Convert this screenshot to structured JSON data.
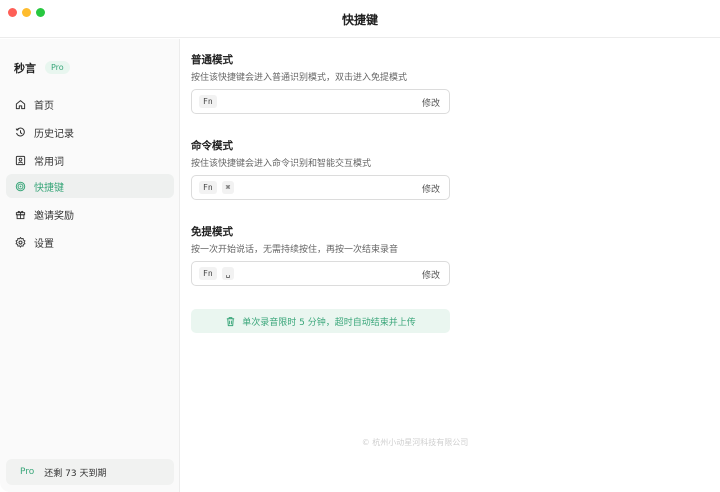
{
  "window": {
    "title": "快捷键"
  },
  "sidebar": {
    "brand": "秒言",
    "badge": "Pro",
    "items": [
      {
        "label": "首页",
        "icon": "home-icon"
      },
      {
        "label": "历史记录",
        "icon": "history-icon"
      },
      {
        "label": "常用词",
        "icon": "words-icon"
      },
      {
        "label": "快捷键",
        "icon": "shortcut-icon",
        "active": true
      },
      {
        "label": "邀请奖励",
        "icon": "gift-icon"
      },
      {
        "label": "设置",
        "icon": "gear-icon"
      }
    ],
    "footer": {
      "badge": "Pro",
      "text": "还剩 73 天到期"
    }
  },
  "main": {
    "sections": [
      {
        "title": "普通模式",
        "desc": "按住该快捷键会进入普通识别模式，双击进入免提模式",
        "keys": [
          "Fn"
        ],
        "edit": "修改"
      },
      {
        "title": "命令模式",
        "desc": "按住该快捷键会进入命令识别和智能交互模式",
        "keys": [
          "Fn",
          "⌘"
        ],
        "edit": "修改"
      },
      {
        "title": "免提模式",
        "desc": "按一次开始说话，无需持续按住，再按一次结束录音",
        "keys": [
          "Fn",
          "␣"
        ],
        "edit": "修改"
      }
    ],
    "notice": "单次录音限时 5 分钟，超时自动结束并上传",
    "copyright": "© 杭州小动星河科技有限公司"
  },
  "colors": {
    "accent": "#3aa67a",
    "accent_bg": "#eaf6f0"
  }
}
